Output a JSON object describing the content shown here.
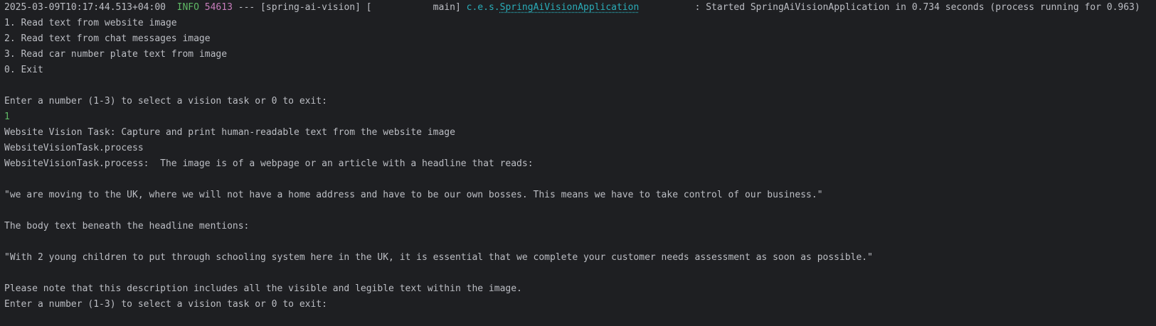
{
  "console": {
    "log_line": {
      "timestamp": "2025-03-09T10:17:44.513+04:00",
      "sep1": "  ",
      "level": "INFO",
      "sep2": " ",
      "pid": "54613",
      "app_part": " --- [spring-ai-vision] [           main] ",
      "logger_prefix": "c.e.s.",
      "logger_class": "SpringAiVisionApplication",
      "logger_pad": "          ",
      "message": ": Started SpringAiVisionApplication in 0.734 seconds (process running for 0.963)"
    },
    "lines": [
      "1. Read text from website image",
      "2. Read text from chat messages image",
      "3. Read car number plate text from image",
      "0. Exit",
      "",
      "Enter a number (1-3) to select a vision task or 0 to exit:"
    ],
    "user_input": "1",
    "output_lines": [
      "Website Vision Task: Capture and print human-readable text from the website image",
      "WebsiteVisionTask.process",
      "WebsiteVisionTask.process:  The image is of a webpage or an article with a headline that reads:",
      "",
      "\"we are moving to the UK, where we will not have a home address and have to be our own bosses. This means we have to take control of our business.\"",
      "",
      "The body text beneath the headline mentions:",
      "",
      "\"With 2 young children to put through schooling system here in the UK, it is essential that we complete your customer needs assessment as soon as possible.\"",
      "",
      "Please note that this description includes all the visible and legible text within the image.",
      "Enter a number (1-3) to select a vision task or 0 to exit:"
    ]
  },
  "colors": {
    "background": "#1e1f22",
    "text": "#bcbec4",
    "info": "#5fb865",
    "pid": "#c77dbb",
    "logger": "#2aacb8",
    "input": "#5fb865"
  }
}
